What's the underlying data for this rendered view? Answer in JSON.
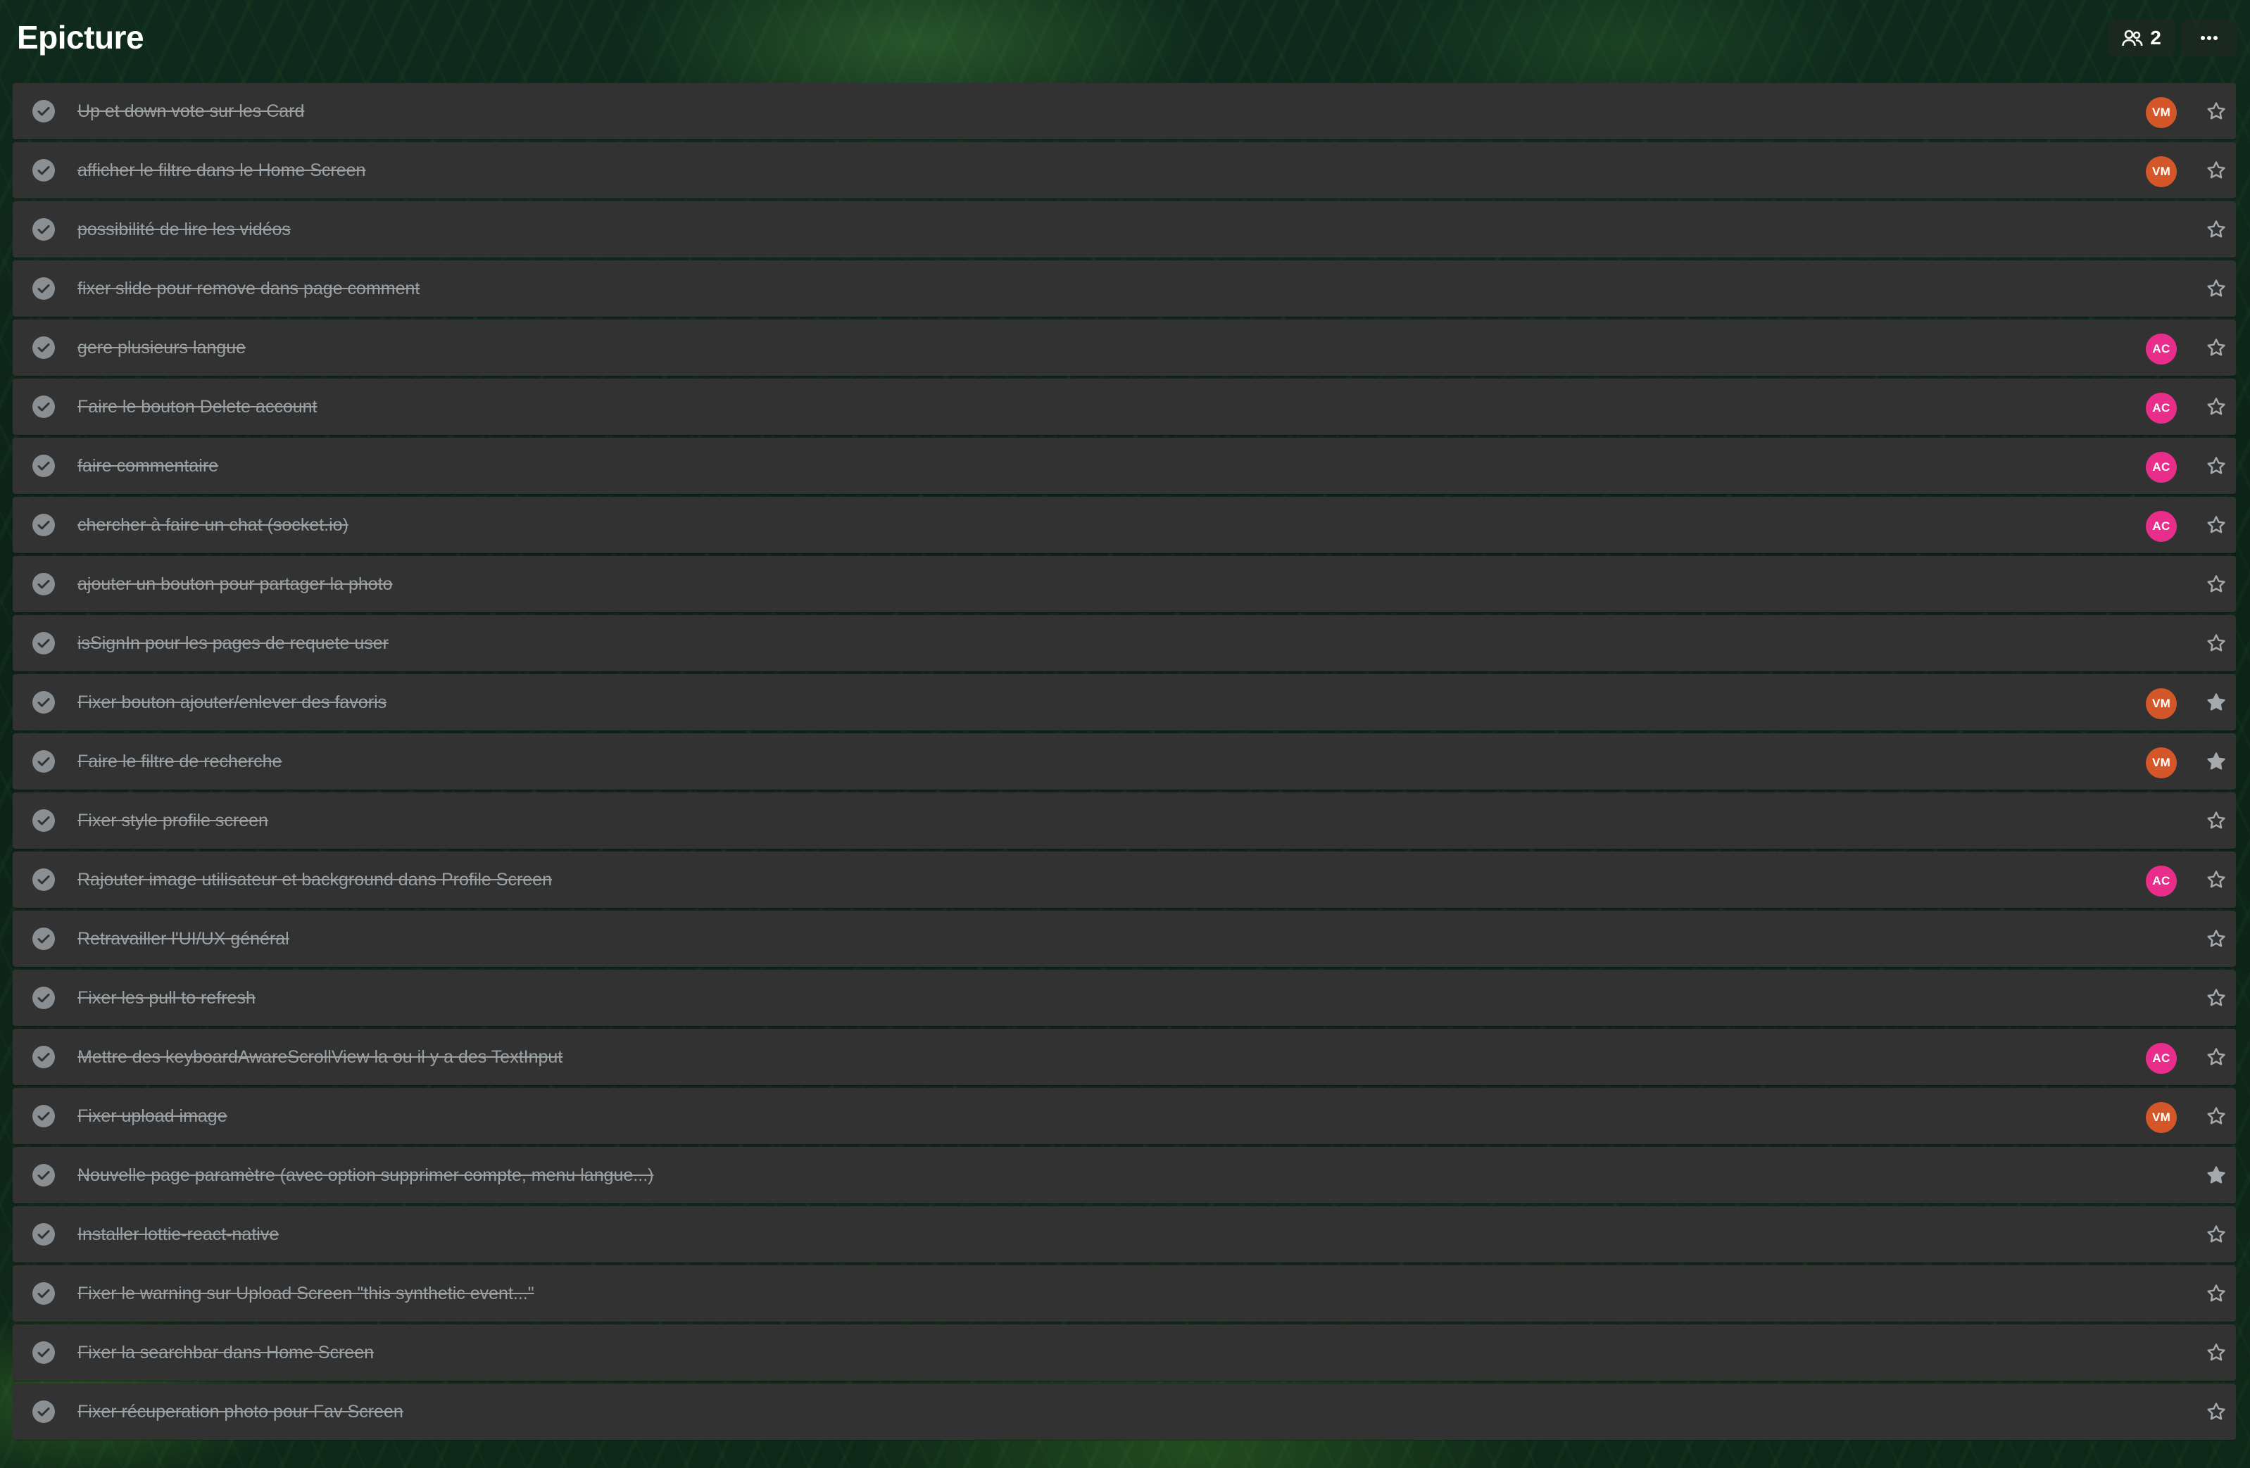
{
  "board": {
    "title": "Epicture",
    "members_count": "2"
  },
  "colors": {
    "avatar_VM": "#d4572a",
    "avatar_AC": "#e82d8a",
    "row_bg": "#323232",
    "text_done": "#9aa0a3",
    "check_bg": "#8a8f93",
    "star": "#a4a9ad"
  },
  "tasks": [
    {
      "title": "Up et down vote sur les Card",
      "completed": true,
      "assignee": "VM",
      "starred": false
    },
    {
      "title": "afficher le filtre dans le Home Screen",
      "completed": true,
      "assignee": "VM",
      "starred": false
    },
    {
      "title": "possibilité de lire les vidéos",
      "completed": true,
      "assignee": "",
      "starred": false
    },
    {
      "title": "fixer slide pour remove dans page comment",
      "completed": true,
      "assignee": "",
      "starred": false
    },
    {
      "title": "gere plusieurs langue",
      "completed": true,
      "assignee": "AC",
      "starred": false
    },
    {
      "title": "Faire le bouton Delete account",
      "completed": true,
      "assignee": "AC",
      "starred": false
    },
    {
      "title": "faire commentaire",
      "completed": true,
      "assignee": "AC",
      "starred": false
    },
    {
      "title": "chercher à faire un chat (socket.io)",
      "completed": true,
      "assignee": "AC",
      "starred": false
    },
    {
      "title": "ajouter un bouton pour partager la photo",
      "completed": true,
      "assignee": "",
      "starred": false
    },
    {
      "title": "isSignIn pour les pages de requete user",
      "completed": true,
      "assignee": "",
      "starred": false
    },
    {
      "title": "Fixer bouton ajouter/enlever des favoris",
      "completed": true,
      "assignee": "VM",
      "starred": true
    },
    {
      "title": "Faire le filtre de recherche",
      "completed": true,
      "assignee": "VM",
      "starred": true
    },
    {
      "title": "Fixer style profile screen",
      "completed": true,
      "assignee": "",
      "starred": false
    },
    {
      "title": "Rajouter image utilisateur et background dans Profile Screen",
      "completed": true,
      "assignee": "AC",
      "starred": false
    },
    {
      "title": "Retravailler l'UI/UX général",
      "completed": true,
      "assignee": "",
      "starred": false
    },
    {
      "title": "Fixer les pull to refresh",
      "completed": true,
      "assignee": "",
      "starred": false
    },
    {
      "title": "Mettre des keyboardAwareScrollView la ou il y a des TextInput",
      "completed": true,
      "assignee": "AC",
      "starred": false
    },
    {
      "title": "Fixer upload image",
      "completed": true,
      "assignee": "VM",
      "starred": false
    },
    {
      "title": "Nouvelle page paramètre (avec option supprimer compte, menu langue...)",
      "completed": true,
      "assignee": "",
      "starred": true
    },
    {
      "title": "Installer lottie-react-native",
      "completed": true,
      "assignee": "",
      "starred": false
    },
    {
      "title": "Fixer le warning sur Upload Screen \"this synthetic event...\"",
      "completed": true,
      "assignee": "",
      "starred": false
    },
    {
      "title": "Fixer la searchbar dans Home Screen",
      "completed": true,
      "assignee": "",
      "starred": false
    },
    {
      "title": "Fixer récuperation photo pour Fav Screen",
      "completed": true,
      "assignee": "",
      "starred": false
    }
  ]
}
